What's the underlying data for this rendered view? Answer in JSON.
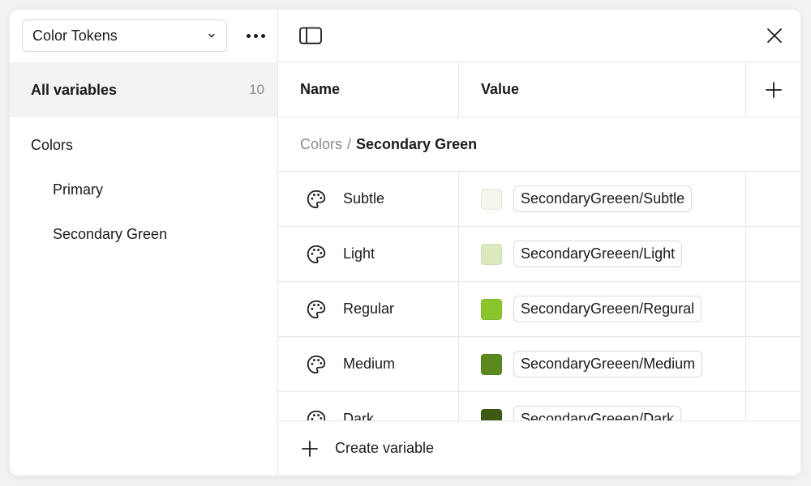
{
  "sidebar": {
    "collection": "Color Tokens",
    "all_variables": {
      "label": "All variables",
      "count": "10"
    },
    "groups": [
      {
        "label": "Colors"
      },
      {
        "label": "Primary"
      },
      {
        "label": "Secondary Green"
      }
    ]
  },
  "table": {
    "columns": {
      "name": "Name",
      "value": "Value"
    },
    "breadcrumb": {
      "parent": "Colors",
      "separator": "/",
      "current": "Secondary Green"
    },
    "rows": [
      {
        "name": "Subtle",
        "alias": "SecondaryGreeen/Subtle",
        "color": "#f3f6ea",
        "icon": "palette-icon"
      },
      {
        "name": "Light",
        "alias": "SecondaryGreeen/Light",
        "color": "#dbe9bd",
        "icon": "palette-icon"
      },
      {
        "name": "Regular",
        "alias": "SecondaryGreeen/Regural",
        "color": "#8cc42c",
        "icon": "palette-icon"
      },
      {
        "name": "Medium",
        "alias": "SecondaryGreeen/Medium",
        "color": "#5a8a1e",
        "icon": "palette-icon"
      },
      {
        "name": "Dark",
        "alias": "SecondaryGreeen/Dark",
        "color": "#3c5a14",
        "icon": "palette-icon"
      }
    ]
  },
  "footer": {
    "create_label": "Create variable"
  }
}
